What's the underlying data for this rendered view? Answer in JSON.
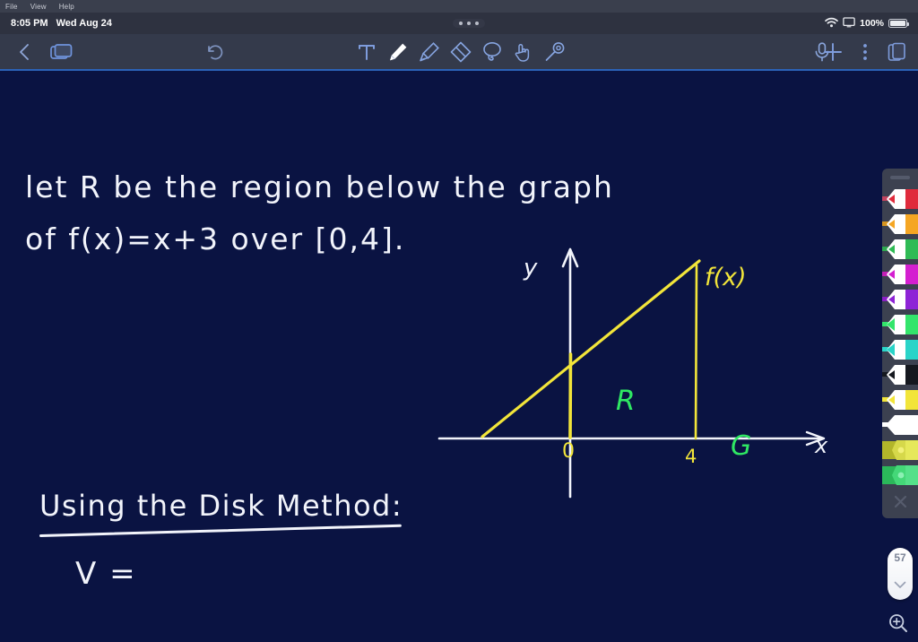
{
  "menubar": {
    "items": [
      "File",
      "View",
      "Help"
    ]
  },
  "statusbar": {
    "time": "8:05 PM",
    "date": "Wed Aug 24",
    "battery_percent": "100%",
    "wifi_icon": "wifi-icon",
    "screen_icon": "screen-mirroring-icon",
    "battery_icon": "battery-full-icon",
    "handle_icon": "three-dots-handle"
  },
  "toolbar": {
    "back": {
      "name": "back-chevron-icon",
      "label": "Back"
    },
    "pages": {
      "name": "pages-icon",
      "label": "Pages"
    },
    "undo": {
      "name": "undo-icon",
      "label": "Undo"
    },
    "tools": [
      {
        "name": "text-tool",
        "label": "Text",
        "glyph": "T",
        "active": false
      },
      {
        "name": "pen-tool",
        "label": "Pen",
        "active": true
      },
      {
        "name": "highlighter-tool",
        "label": "Highlighter",
        "active": false
      },
      {
        "name": "eraser-tool",
        "label": "Eraser",
        "active": false
      },
      {
        "name": "lasso-tool",
        "label": "Lasso",
        "active": false
      },
      {
        "name": "hand-tool",
        "label": "Hand",
        "active": false
      },
      {
        "name": "laser-pointer-tool",
        "label": "Laser Pointer",
        "active": false
      }
    ],
    "mic": {
      "name": "microphone-icon",
      "label": "Record Audio"
    },
    "add": {
      "name": "plus-icon",
      "label": "Add"
    },
    "more": {
      "name": "more-vertical-icon",
      "label": "More"
    },
    "duplicate": {
      "name": "duplicate-page-icon",
      "label": "Duplicate Page"
    }
  },
  "notes": {
    "line1": "let R  be the  region  below  the  graph",
    "line2": "of  f(x)=x+3   over   [0,4].",
    "line3": "Using the  Disk  Method:",
    "line4": "V ="
  },
  "graph": {
    "y_axis_label": "y",
    "x_axis_label": "x",
    "function_label": "f(x)",
    "region_label": "R",
    "annotation_label": "G",
    "tick_0": "0",
    "tick_4": "4"
  },
  "chart_data": {
    "type": "line",
    "title": "",
    "xlabel": "x",
    "ylabel": "y",
    "function": "f(x) = x + 3",
    "interval": [
      0,
      4
    ],
    "x": [
      -3,
      0,
      4
    ],
    "y": [
      0,
      3,
      7
    ],
    "series": [
      {
        "name": "f(x) = x + 3",
        "values": [
          0,
          3,
          7
        ],
        "color": "#f2e53a"
      }
    ],
    "shaded_region": {
      "name": "R",
      "x_from": 0,
      "x_to": 4,
      "color": "#2fe863"
    },
    "vertical_markers": [
      {
        "x": 0,
        "label": "0",
        "height": 3,
        "color": "#f2e53a"
      },
      {
        "x": 4,
        "label": "4",
        "height": 7,
        "color": "#f2e53a"
      }
    ],
    "axis_color": "#f2f4fb",
    "grid": false,
    "legend": false,
    "xlim": [
      -4,
      8
    ],
    "ylim": [
      -2,
      9
    ]
  },
  "pens": [
    {
      "name": "pen-red",
      "barrel": "#c2445f",
      "tip": "#e02b3c"
    },
    {
      "name": "pen-orange",
      "barrel": "#d79520",
      "tip": "#f5a623"
    },
    {
      "name": "pen-green",
      "barrel": "#2fa84f",
      "tip": "#2fbb55"
    },
    {
      "name": "pen-magenta",
      "barrel": "#c21fb5",
      "tip": "#d41fd0"
    },
    {
      "name": "pen-purple",
      "barrel": "#8a1fc4",
      "tip": "#8e24d6"
    },
    {
      "name": "pen-bright-green",
      "barrel": "#33e56b",
      "tip": "#33e56b"
    },
    {
      "name": "pen-cyan",
      "barrel": "#2ad4c8",
      "tip": "#2ad4c8"
    },
    {
      "name": "pen-black",
      "barrel": "#15181f",
      "tip": "#15181f"
    },
    {
      "name": "pen-yellow",
      "barrel": "#f2e53a",
      "tip": "#f2e53a"
    },
    {
      "name": "pen-white",
      "barrel": "#ffffff",
      "tip": "#ffffff"
    },
    {
      "name": "highlighter-olive",
      "barrel": "#b2b52a",
      "tip": "#d6d84a"
    },
    {
      "name": "highlighter-green",
      "barrel": "#2bb85a",
      "tip": "#44d878"
    }
  ],
  "sidebar": {
    "close_label": "Close palette",
    "close_icon": "close-x-icon",
    "size_value": "57",
    "size_chevron_icon": "chevron-down-icon",
    "zoom_icon": "zoom-in-icon"
  }
}
